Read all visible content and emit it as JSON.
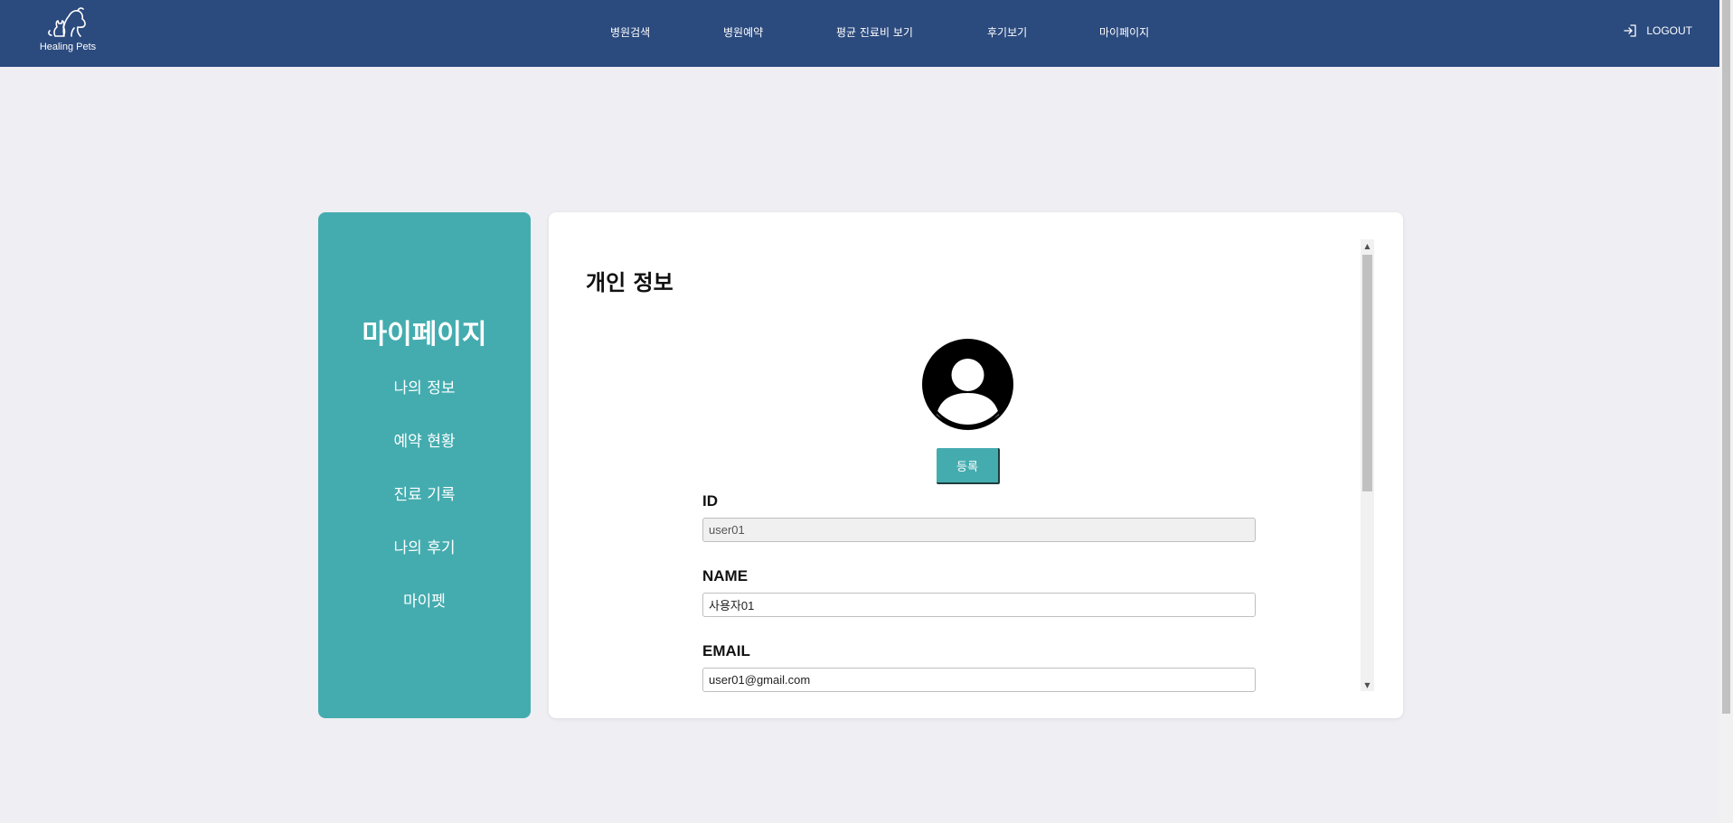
{
  "header": {
    "logo_text": "Healing Pets",
    "nav": [
      {
        "label": "병원검색"
      },
      {
        "label": "병원예약"
      },
      {
        "label": "평균 진료비 보기"
      },
      {
        "label": "후기보기"
      },
      {
        "label": "마이페이지"
      }
    ],
    "logout_label": "LOGOUT"
  },
  "sidebar": {
    "title": "마이페이지",
    "items": [
      {
        "label": "나의 정보"
      },
      {
        "label": "예약 현황"
      },
      {
        "label": "진료 기록"
      },
      {
        "label": "나의 후기"
      },
      {
        "label": "마이펫"
      }
    ]
  },
  "main": {
    "title": "개인 정보",
    "register_button": "등록",
    "fields": {
      "id": {
        "label": "ID",
        "value": "user01"
      },
      "name": {
        "label": "NAME",
        "value": "사용자01"
      },
      "email": {
        "label": "EMAIL",
        "value": "user01@gmail.com"
      }
    }
  },
  "colors": {
    "header_bg": "#2b4a7e",
    "accent": "#44acaf",
    "page_bg": "#eeeef3"
  }
}
